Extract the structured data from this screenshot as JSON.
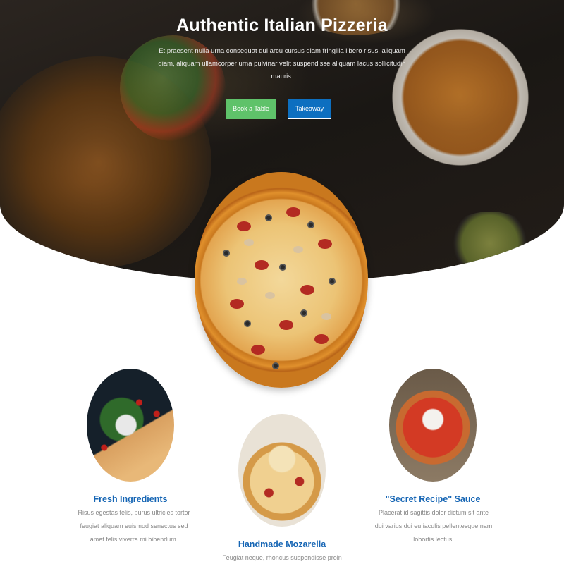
{
  "hero": {
    "title": "Authentic Italian Pizzeria",
    "description": "Et praesent nulla urna consequat dui arcu cursus diam fringilla libero risus, aliquam diam, aliquam ullamcorper urna pulvinar velit suspendisse aliquam lacus sollicitudin mauris.",
    "buttons": {
      "book": "Book a Table",
      "takeaway": "Takeaway"
    }
  },
  "features": [
    {
      "title": "Fresh Ingredients",
      "text": "Risus egestas felis, purus ultricies tortor feugiat aliquam euismod senectus sed amet felis viverra mi bibendum."
    },
    {
      "title": "Handmade Mozarella",
      "text": "Feugiat neque, rhoncus suspendisse proin"
    },
    {
      "title": "\"Secret Recipe\" Sauce",
      "text": "Placerat id sagittis dolor dictum sit ante dui varius dui eu iaculis pellentesque nam lobortis lectus."
    }
  ],
  "colors": {
    "accent_blue": "#1565b4",
    "button_green": "#5fc26a",
    "button_blue": "#0d6fc0",
    "body_text": "#888888"
  }
}
